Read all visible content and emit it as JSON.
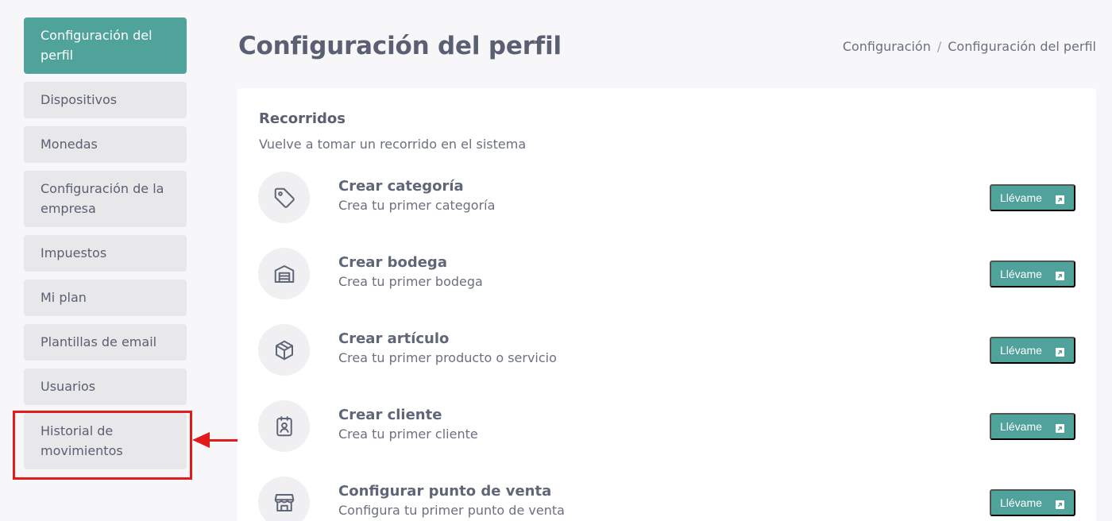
{
  "sidebar": {
    "items": [
      {
        "label": "Configuración del perfil",
        "active": true
      },
      {
        "label": "Dispositivos"
      },
      {
        "label": "Monedas"
      },
      {
        "label": "Configuración de la empresa"
      },
      {
        "label": "Impuestos"
      },
      {
        "label": "Mi plan"
      },
      {
        "label": "Plantillas de email"
      },
      {
        "label": "Usuarios"
      },
      {
        "label": "Historial de movimientos"
      }
    ]
  },
  "header": {
    "title": "Configuración del perfil",
    "breadcrumb": [
      "Configuración",
      "Configuración del perfil"
    ],
    "breadcrumb_separator": "/"
  },
  "tours": {
    "title": "Recorridos",
    "subtitle": "Vuelve a tomar un recorrido en el sistema",
    "items": [
      {
        "icon": "tag-icon",
        "title": "Crear categoría",
        "description": "Crea tu primer categoría",
        "button": "Llévame"
      },
      {
        "icon": "warehouse-icon",
        "title": "Crear bodega",
        "description": "Crea tu primer bodega",
        "button": "Llévame"
      },
      {
        "icon": "box-icon",
        "title": "Crear artículo",
        "description": "Crea tu primer producto o servicio",
        "button": "Llévame"
      },
      {
        "icon": "contact-badge-icon",
        "title": "Crear cliente",
        "description": "Crea tu primer cliente",
        "button": "Llévame"
      },
      {
        "icon": "store-icon",
        "title": "Configurar punto de venta",
        "description": "Configura tu primer punto de venta",
        "button": "Llévame"
      }
    ]
  },
  "colors": {
    "accent": "#4fa39b",
    "annotation": "#e11b1b"
  }
}
